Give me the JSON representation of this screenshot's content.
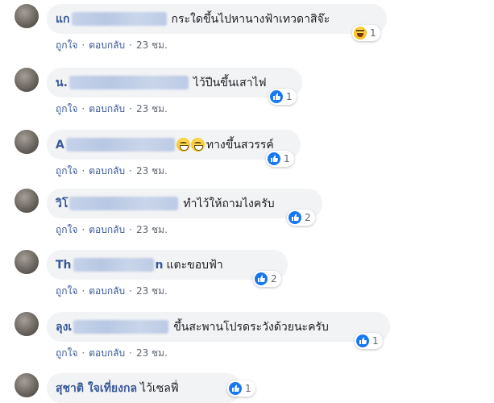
{
  "comments": [
    {
      "name": "แก",
      "text": "กระใดขึ้นไปหานางฟ้าเทวดาสิจ๊ะ",
      "reaction_count": "1",
      "reaction_type": "haha"
    },
    {
      "name": "น.",
      "text": "ไว้ปีนขึ้นเสาไฟ",
      "reaction_count": "1",
      "reaction_type": "like"
    },
    {
      "name": "A",
      "text": "ทางขึ้นสวรรค์",
      "reaction_count": "1",
      "reaction_type": "like"
    },
    {
      "name": "วิโ",
      "text": "ทำไว้ให้ถามไงครับ",
      "reaction_count": "2",
      "reaction_type": "like"
    },
    {
      "name": "Th",
      "name_tail": "n",
      "text": "แตะขอบฟ้า",
      "reaction_count": "2",
      "reaction_type": "like"
    },
    {
      "name": "ลุงเ",
      "text": "ขึ้นสะพานโปรดระวังด้วยนะครับ",
      "reaction_count": "1",
      "reaction_type": "like"
    },
    {
      "name": "สุชาติ ใจเที่ยงกล",
      "text": "ไว้เซลฟี่",
      "reaction_count": "1",
      "reaction_type": "like"
    }
  ],
  "actions": {
    "like": "ถูกใจ",
    "reply": "ตอบกลับ",
    "separator": "·",
    "time": "23 ชม."
  },
  "colors": {
    "bubble_bg": "#f2f3f5",
    "name": "#385898",
    "like_blue": "#1877f2",
    "meta_gray": "#606770"
  }
}
